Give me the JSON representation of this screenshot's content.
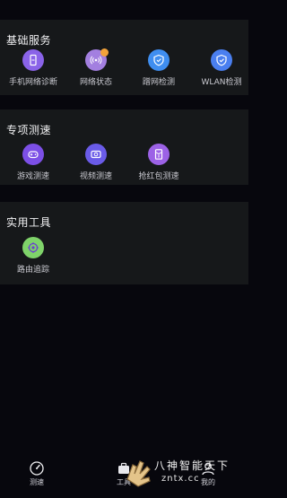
{
  "sections": [
    {
      "title": "基础服务",
      "items": [
        {
          "label": "手机网络诊断",
          "icon": "phone-diagnose-icon",
          "color": "#8a63e8"
        },
        {
          "label": "网络状态",
          "icon": "network-status-icon",
          "color": "#a37fe0"
        },
        {
          "label": "蹭网检测",
          "icon": "freeload-detect-icon",
          "color": "#3f8ef0"
        },
        {
          "label": "WLAN检测",
          "icon": "wlan-detect-icon",
          "color": "#4a7ff0"
        }
      ]
    },
    {
      "title": "专项测速",
      "items": [
        {
          "label": "游戏测速",
          "icon": "game-speed-icon",
          "color": "#7c4fe6"
        },
        {
          "label": "视频测速",
          "icon": "video-speed-icon",
          "color": "#6a5be8"
        },
        {
          "label": "抢红包测速",
          "icon": "red-envelope-speed-icon",
          "color": "#9c62e6"
        }
      ]
    },
    {
      "title": "实用工具",
      "items": [
        {
          "label": "路由追踪",
          "icon": "route-trace-icon",
          "color": "#7fd36a"
        }
      ]
    }
  ],
  "tabs": [
    {
      "label": "测速",
      "icon": "speedometer-icon"
    },
    {
      "label": "工具",
      "icon": "toolbox-icon"
    },
    {
      "label": "我的",
      "icon": "profile-icon"
    }
  ],
  "watermark": {
    "text": "八神智能天下",
    "url": "zntx.cc"
  }
}
